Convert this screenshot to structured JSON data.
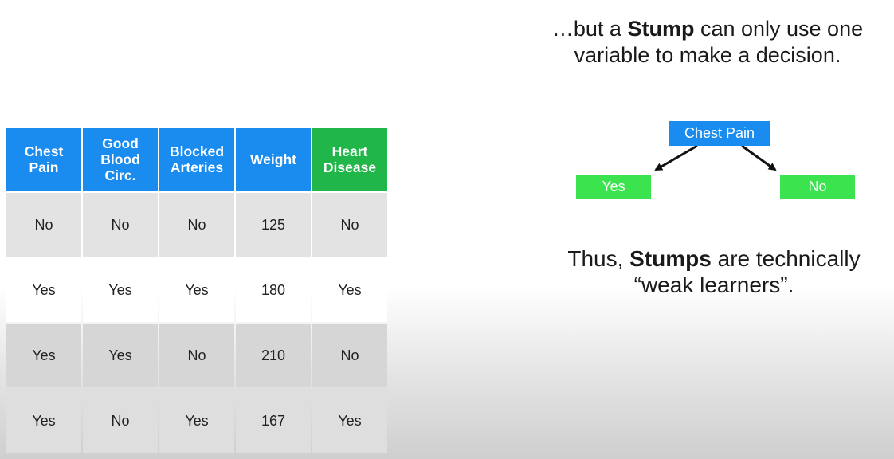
{
  "table": {
    "headers": [
      "Chest\nPain",
      "Good\nBlood\nCirc.",
      "Blocked\nArteries",
      "Weight",
      "Heart\nDisease"
    ],
    "rows": [
      [
        "No",
        "No",
        "No",
        "125",
        "No"
      ],
      [
        "Yes",
        "Yes",
        "Yes",
        "180",
        "Yes"
      ],
      [
        "Yes",
        "Yes",
        "No",
        "210",
        "No"
      ],
      [
        "Yes",
        "No",
        "Yes",
        "167",
        "Yes"
      ]
    ]
  },
  "captions": {
    "top_pre": "…but a ",
    "top_bold": "Stump",
    "top_post1": " can only use one",
    "top_post2": "variable to make a decision.",
    "bottom_pre": "Thus, ",
    "bottom_bold": "Stumps",
    "bottom_post1": " are technically",
    "bottom_post2": "“weak learners”."
  },
  "stump": {
    "root": "Chest Pain",
    "left": "Yes",
    "right": "No"
  },
  "colors": {
    "header_blue": "#1a8cf0",
    "header_green": "#21b64a",
    "leaf_green": "#3be34f"
  }
}
